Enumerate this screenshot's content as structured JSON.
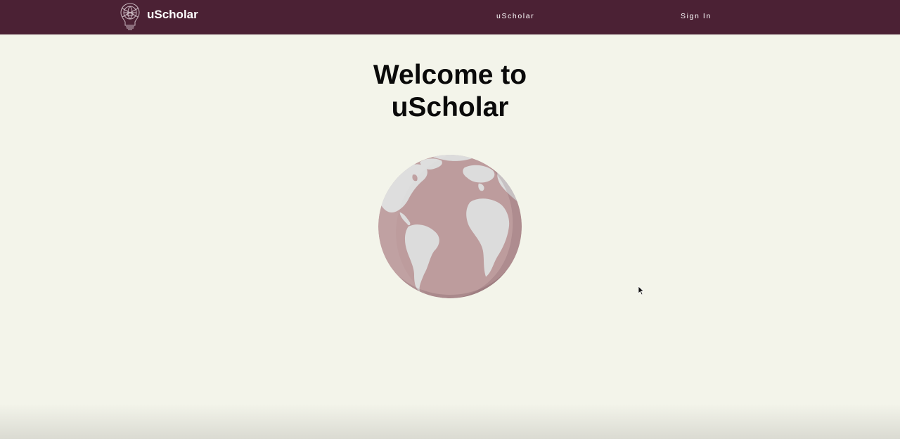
{
  "navbar": {
    "brand_name": "uScholar",
    "brand_logo_icon": "lightbulb-globe-icon",
    "links": [
      {
        "label": "uScholar"
      },
      {
        "label": "Sign In"
      }
    ],
    "background_color": "#4b2134"
  },
  "main": {
    "title_line1": "Welcome to",
    "title_line2": "uScholar",
    "hero_icon": "globe-icon",
    "background_color": "#f3f4ea"
  }
}
